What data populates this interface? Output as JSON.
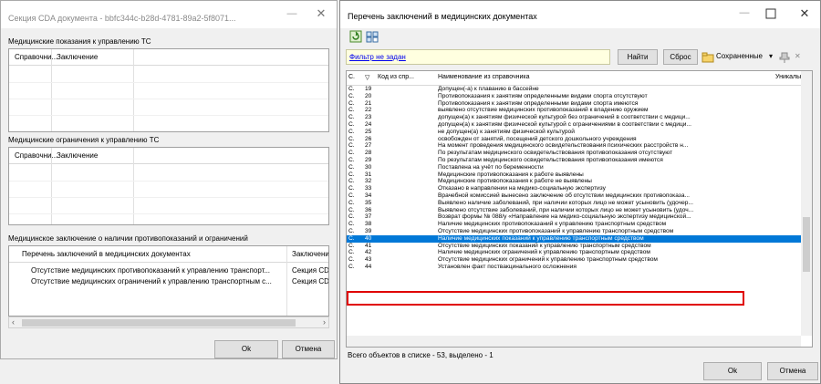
{
  "left_window": {
    "title": "Секция CDA документа - bbfc344c-b28d-4781-89a2-5f8071...",
    "sections": [
      {
        "label": "Медицинские показания к управлению ТС",
        "col1": "Справочни...",
        "col2": "Заключение"
      },
      {
        "label": "Медицинские ограничения к управлению ТС",
        "col1": "Справочни...",
        "col2": "Заключение"
      },
      {
        "label": "Медицинское заключение о наличии противопоказаний и ограничений",
        "col1": "Перечень заключений в медицинских документах",
        "col2": "Заключени"
      }
    ],
    "conclusion_rows": [
      {
        "name": "Отсутствие медицинских противопоказаний к управлению транспорт...",
        "value": "Секция CD"
      },
      {
        "name": "Отсутствие медицинских ограничений к управлению транспортным с...",
        "value": "Секция CD"
      }
    ],
    "ok_label": "Ok",
    "cancel_label": "Отмена"
  },
  "right_window": {
    "title": "Перечень заключений в медицинских документах",
    "filter_text": "Фильтр не задан",
    "find_label": "Найти",
    "reset_label": "Сброс",
    "saved_label": "Сохраненные",
    "columns": {
      "c1": "С.",
      "c2": "Код из спр...",
      "c3": "Наименование из справочника",
      "c4": "Уникальн"
    },
    "rows": [
      {
        "c1": "С.",
        "c2": "19",
        "c3": "Допущен(-а) к плаванию в бассейне",
        "c4": ""
      },
      {
        "c1": "С.",
        "c2": "20",
        "c3": "Противопоказания к занятиям определенными видами спорта отсутствуют",
        "c4": ""
      },
      {
        "c1": "С.",
        "c2": "21",
        "c3": "Противопоказания к занятиям определенными видами спорта имеются",
        "c4": ""
      },
      {
        "c1": "С.",
        "c2": "22",
        "c3": "выявлено отсутствие медицинских противопоказаний к владению оружием",
        "c4": ""
      },
      {
        "c1": "С.",
        "c2": "23",
        "c3": "допущен(а) к занятиям физической культурой без ограничений в соответствии с медици...",
        "c4": ""
      },
      {
        "c1": "С.",
        "c2": "24",
        "c3": "допущен(а) к занятиям физической культурой с ограничениями в соответствии с медици...",
        "c4": ""
      },
      {
        "c1": "С.",
        "c2": "25",
        "c3": "не допущен(а) к занятиям физической культурой",
        "c4": ""
      },
      {
        "c1": "С.",
        "c2": "26",
        "c3": "освобожден от занятий, посещений детского дошкольного учреждения",
        "c4": ""
      },
      {
        "c1": "С.",
        "c2": "27",
        "c3": "На момент проведения медицинского освидетельствования психических расстройств н...",
        "c4": ""
      },
      {
        "c1": "С.",
        "c2": "28",
        "c3": "По результатам медицинского освидетельствования противопоказания отсутствуют",
        "c4": ""
      },
      {
        "c1": "С.",
        "c2": "29",
        "c3": "По результатам медицинского освидетельствования противопоказания имеются",
        "c4": ""
      },
      {
        "c1": "С.",
        "c2": "30",
        "c3": "Поставлена на учёт по беременности",
        "c4": ""
      },
      {
        "c1": "С.",
        "c2": "31",
        "c3": "Медицинские противопоказания к работе выявлены",
        "c4": ""
      },
      {
        "c1": "С.",
        "c2": "32",
        "c3": "Медицинские противопоказания к работе не выявлены",
        "c4": ""
      },
      {
        "c1": "С.",
        "c2": "33",
        "c3": "Отказано в направлении на медико-социальную экспертизу",
        "c4": ""
      },
      {
        "c1": "С.",
        "c2": "34",
        "c3": "Врачебной комиссией вынесено заключение об отсутствии медицинских противопоказа...",
        "c4": ""
      },
      {
        "c1": "С.",
        "c2": "35",
        "c3": "Выявлено наличие заболеваний, при наличии которых лицо не может усыновить (удочер...",
        "c4": ""
      },
      {
        "c1": "С.",
        "c2": "36",
        "c3": "Выявлено отсутствие заболеваний, при наличии которых лицо не может усыновить (удоч...",
        "c4": ""
      },
      {
        "c1": "С.",
        "c2": "37",
        "c3": "Возврат формы № 088/у «Направление на медико-социальную экспертизу медицинской...",
        "c4": ""
      },
      {
        "c1": "С.",
        "c2": "38",
        "c3": "Наличие медицинских противопоказаний к управлению транспортным средством",
        "c4": ""
      },
      {
        "c1": "С.",
        "c2": "39",
        "c3": "Отсутствие медицинских противопоказаний к управлению транспортным средством",
        "c4": ""
      },
      {
        "c1": "С.",
        "c2": "40",
        "c3": "Наличие медицинских показаний к управлению транспортным средством",
        "c4": "",
        "selected": true
      },
      {
        "c1": "С.",
        "c2": "41",
        "c3": "Отсутствие медицинских показаний к управлению транспортным средством",
        "c4": ""
      },
      {
        "c1": "С.",
        "c2": "42",
        "c3": "Наличие медицинских ограничений к управлению транспортным средством",
        "c4": ""
      },
      {
        "c1": "С.",
        "c2": "43",
        "c3": "Отсутствие медицинских ограничений к управлению транспортным средством",
        "c4": ""
      },
      {
        "c1": "С.",
        "c2": "44",
        "c3": "Установлен факт поствакцинального осложнения",
        "c4": ""
      }
    ],
    "status": "Всего объектов в списке - 53, выделено - 1",
    "ok_label": "Ok",
    "cancel_label": "Отмена"
  },
  "colors": {
    "selection": "#0078d7",
    "highlight_box": "#e00000",
    "link": "#0000ee"
  }
}
